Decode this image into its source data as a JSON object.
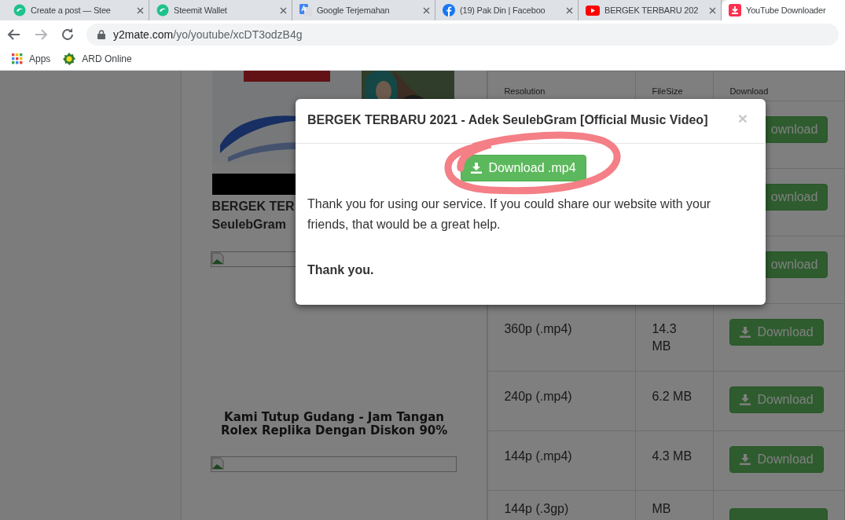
{
  "browser": {
    "tabs": [
      {
        "title": "Create a post — Stee",
        "selected": false
      },
      {
        "title": "Steemit Wallet",
        "selected": false
      },
      {
        "title": "Google Terjemahan",
        "selected": false
      },
      {
        "title": "(19) Pak Din | Faceboo",
        "selected": false
      },
      {
        "title": "BERGEK TERBARU 202",
        "selected": false
      },
      {
        "title": "YouTube Downloader",
        "selected": true
      }
    ],
    "address": {
      "domain": "y2mate.com",
      "path": "/yo/youtube/xcDT3odzB4g"
    },
    "bookmarks": [
      {
        "label": "Apps"
      },
      {
        "label": "ARD Online"
      }
    ]
  },
  "page": {
    "video": {
      "title_lines": [
        "BERGEK TER",
        "SeulebGram"
      ]
    },
    "ad": {
      "text": "Kami Tutup Gudang - Jam Tangan Rolex Replika Dengan Diskon 90%"
    },
    "table": {
      "columns": [
        "Resolution",
        "FileSize",
        "Download"
      ],
      "rows": [
        {
          "download": "ownload"
        },
        {
          "download": "ownload"
        },
        {
          "download": "ownload"
        },
        {
          "resolution": "360p (.mp4)",
          "size": "14.3 MB",
          "download": "Download"
        },
        {
          "resolution": "240p (.mp4)",
          "size": "6.2 MB",
          "download": "Download"
        },
        {
          "resolution": "144p (.mp4)",
          "size": "4.3 MB",
          "download": "Download"
        },
        {
          "resolution": "144p (.3gp)",
          "size": "MB"
        }
      ]
    }
  },
  "modal": {
    "title": "BERGEK TERBARU 2021 - Adek SeulebGram [Official Music Video]",
    "close": "×",
    "button": "Download .mp4",
    "message": "Thank you for using our service. If you could share our website with your friends, that would be a great help.",
    "closing": "Thank you."
  }
}
